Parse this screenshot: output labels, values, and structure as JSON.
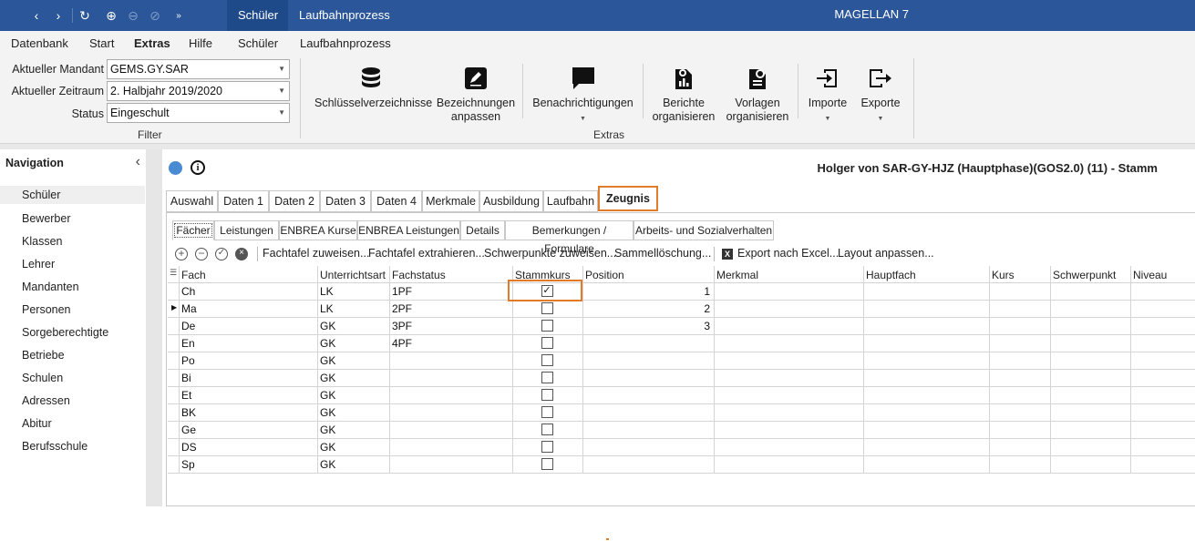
{
  "titlebar": {
    "tabs": [
      "Schüler",
      "Laufbahnprozess"
    ],
    "app_title": "MAGELLAN 7"
  },
  "menu": [
    "Datenbank",
    "Start",
    "Extras",
    "Hilfe",
    "Schüler",
    "Laufbahnprozess"
  ],
  "filter": {
    "group_label": "Filter",
    "mandant_label": "Aktueller Mandant",
    "mandant_value": "GEMS.GY.SAR",
    "zeitraum_label": "Aktueller Zeitraum",
    "zeitraum_value": "2. Halbjahr 2019/2020",
    "status_label": "Status",
    "status_value": "Eingeschult"
  },
  "ribbon": {
    "group_label": "Extras",
    "schluessel": "Schlüsselverzeichnisse",
    "bez1": "Bezeichnungen",
    "bez2": "anpassen",
    "benach": "Benachrichtigungen",
    "berichte1": "Berichte",
    "berichte2": "organisieren",
    "vorlagen1": "Vorlagen",
    "vorlagen2": "organisieren",
    "importe": "Importe",
    "exporte": "Exporte"
  },
  "nav": {
    "title": "Navigation",
    "items": [
      "Schüler",
      "Bewerber",
      "Klassen",
      "Lehrer",
      "Mandanten",
      "Personen",
      "Sorgeberechtigte",
      "Betriebe",
      "Schulen",
      "Adressen",
      "Abitur",
      "Berufsschule"
    ]
  },
  "record_title": "Holger von SAR-GY-HJZ (Hauptphase)(GOS2.0) (11) - Stamm",
  "tabs": [
    "Auswahl",
    "Daten 1",
    "Daten 2",
    "Daten 3",
    "Daten 4",
    "Merkmale",
    "Ausbildung",
    "Laufbahn",
    "Zeugnis"
  ],
  "subtabs": [
    "Fächer",
    "Leistungen",
    "ENBREA Kurse",
    "ENBREA Leistungen",
    "Details",
    "Bemerkungen / Formulare",
    "Arbeits- und Sozialverhalten"
  ],
  "toolbar": {
    "fachtafel_zuweisen": "Fachtafel zuweisen...",
    "fachtafel_extrahieren": "Fachtafel extrahieren...",
    "schwerpunkte": "Schwerpunkte zuweisen...",
    "sammel": "Sammellöschung...",
    "export": "Export nach Excel...",
    "layout": "Layout anpassen..."
  },
  "grid": {
    "headers": [
      "Fach",
      "Unterrichtsart",
      "Fachstatus",
      "Stammkurs",
      "Position",
      "Merkmal",
      "Hauptfach",
      "Kurs",
      "Schwerpunkt",
      "Niveau"
    ],
    "rows": [
      {
        "fach": "Ch",
        "art": "LK",
        "status": "1PF",
        "stamm": true,
        "pos": "1"
      },
      {
        "fach": "Ma",
        "art": "LK",
        "status": "2PF",
        "stamm": false,
        "pos": "2"
      },
      {
        "fach": "De",
        "art": "GK",
        "status": "3PF",
        "stamm": false,
        "pos": "3"
      },
      {
        "fach": "En",
        "art": "GK",
        "status": "4PF",
        "stamm": false,
        "pos": ""
      },
      {
        "fach": "Po",
        "art": "GK",
        "status": "",
        "stamm": false,
        "pos": ""
      },
      {
        "fach": "Bi",
        "art": "GK",
        "status": "",
        "stamm": false,
        "pos": ""
      },
      {
        "fach": "Et",
        "art": "GK",
        "status": "",
        "stamm": false,
        "pos": ""
      },
      {
        "fach": "BK",
        "art": "GK",
        "status": "",
        "stamm": false,
        "pos": ""
      },
      {
        "fach": "Ge",
        "art": "GK",
        "status": "",
        "stamm": false,
        "pos": ""
      },
      {
        "fach": "DS",
        "art": "GK",
        "status": "",
        "stamm": false,
        "pos": ""
      },
      {
        "fach": "Sp",
        "art": "GK",
        "status": "",
        "stamm": false,
        "pos": ""
      }
    ]
  },
  "colors": {
    "titlebar": "#2b579a",
    "highlight": "#e07b2a",
    "status_dot": "#4a8cd4"
  }
}
